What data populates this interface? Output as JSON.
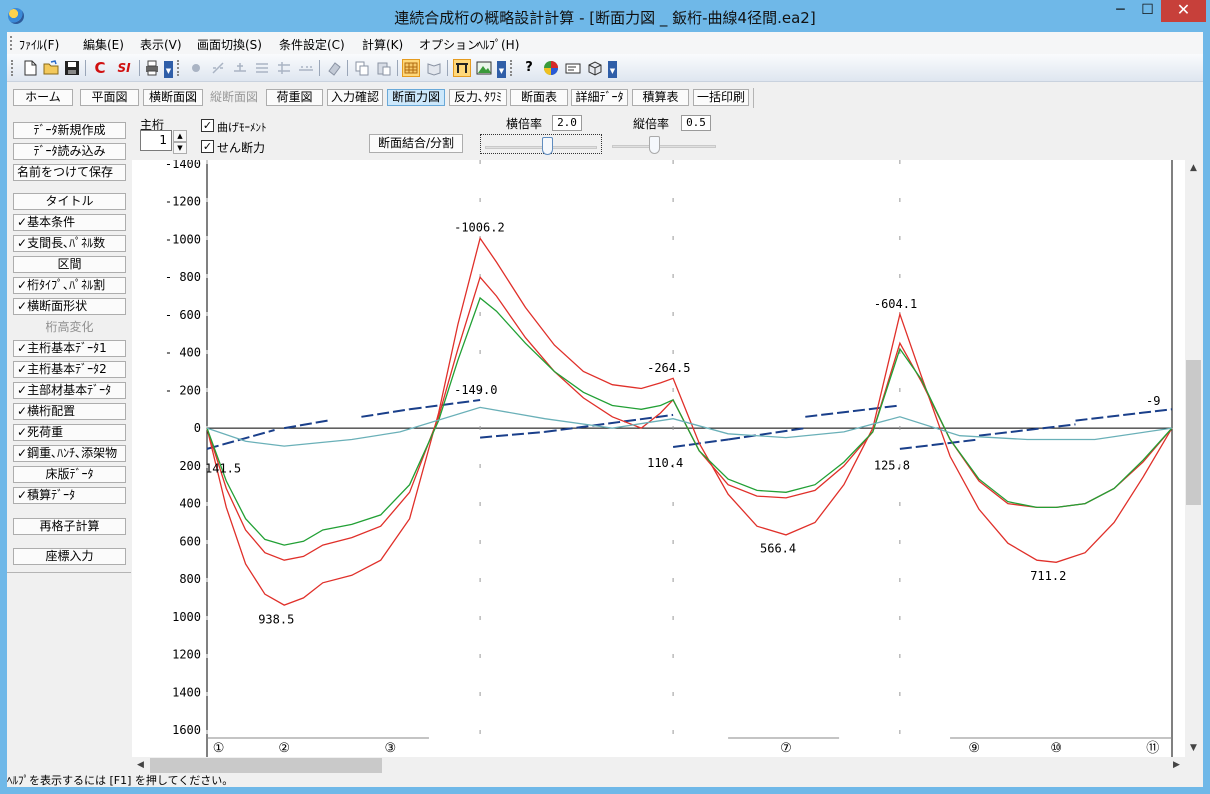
{
  "window": {
    "title": "連続合成桁の概略設計計算 - [断面力図 _ 鈑桁-曲線4径間.ea2]",
    "minimize": "─",
    "maximize": "☐",
    "close": "✕"
  },
  "menu": [
    "ﾌｧｲﾙ(F)",
    "編集(E)",
    "表示(V)",
    "画面切換(S)",
    "条件設定(C)",
    "計算(K)",
    "オプション",
    "ﾍﾙﾌﾟ(H)"
  ],
  "toolbar": {
    "icons": [
      "new-file-icon",
      "open-folder-icon",
      "save-icon",
      "c-icon",
      "si-icon",
      "print-icon",
      "tool-1-icon",
      "tool-2-icon",
      "tool-3-icon",
      "tool-4-icon",
      "tool-5-icon",
      "tool-6-icon",
      "eraser-icon",
      "copy-icon",
      "paste-icon",
      "grid-view-icon",
      "book-icon",
      "frame-icon",
      "mountain-icon",
      "help-icon",
      "color-wheel-icon",
      "card-icon",
      "box-icon"
    ],
    "glyphs": {
      "c": "C",
      "si": "SI",
      "help": "?"
    }
  },
  "nav_tabs": [
    {
      "label": "ホーム",
      "state": "normal"
    },
    {
      "label": "平面図",
      "state": "normal"
    },
    {
      "label": "横断面図",
      "state": "normal"
    },
    {
      "label": "縦断面図",
      "state": "disabled"
    },
    {
      "label": "荷重図",
      "state": "normal"
    },
    {
      "label": "入力確認",
      "state": "normal"
    },
    {
      "label": "断面力図",
      "state": "active"
    },
    {
      "label": "反力､ﾀﾜﾐ",
      "state": "normal"
    },
    {
      "label": "断面表",
      "state": "normal"
    },
    {
      "label": "詳細ﾃﾞｰﾀ",
      "state": "normal"
    },
    {
      "label": "積算表",
      "state": "normal"
    },
    {
      "label": "一括印刷",
      "state": "normal"
    }
  ],
  "sidebar": [
    {
      "label": "ﾃﾞｰﾀ新規作成",
      "state": "normal",
      "check": false
    },
    {
      "label": "ﾃﾞｰﾀ読み込み",
      "state": "normal",
      "check": false
    },
    {
      "label": "名前をつけて保存",
      "state": "normal",
      "check": false
    },
    {
      "label": "タイトル",
      "state": "normal",
      "check": false
    },
    {
      "label": "基本条件",
      "state": "normal",
      "check": true
    },
    {
      "label": "支間長､ﾊﾟﾈﾙ数",
      "state": "normal",
      "check": true
    },
    {
      "label": "区間",
      "state": "normal",
      "check": false
    },
    {
      "label": "桁ﾀｲﾌﾟ､ﾊﾟﾈﾙ割",
      "state": "normal",
      "check": true
    },
    {
      "label": "横断面形状",
      "state": "normal",
      "check": true
    },
    {
      "label": "桁高変化",
      "state": "disabled",
      "check": false
    },
    {
      "label": "主桁基本ﾃﾞｰﾀ1",
      "state": "normal",
      "check": true
    },
    {
      "label": "主桁基本ﾃﾞｰﾀ2",
      "state": "normal",
      "check": true
    },
    {
      "label": "主部材基本ﾃﾞｰﾀ",
      "state": "normal",
      "check": true
    },
    {
      "label": "横桁配置",
      "state": "normal",
      "check": true
    },
    {
      "label": "死荷重",
      "state": "normal",
      "check": true
    },
    {
      "label": "鋼重､ﾊﾝﾁ､添架物",
      "state": "normal",
      "check": true
    },
    {
      "label": "床版ﾃﾞｰﾀ",
      "state": "normal",
      "check": false
    },
    {
      "label": "積算ﾃﾞｰﾀ",
      "state": "normal",
      "check": true
    },
    {
      "label": "再格子計算",
      "state": "normal",
      "check": false
    },
    {
      "label": "座標入力",
      "state": "normal",
      "check": false
    }
  ],
  "check_glyph": "✓",
  "controls": {
    "girder_label": "主桁",
    "girder_value": "1",
    "bending_label": "曲げﾓｰﾒﾝﾄ",
    "bending_checked": true,
    "shear_label": "せん断力",
    "shear_checked": true,
    "combine_button": "断面結合/分割",
    "h_scale_label": "横倍率",
    "h_scale_value": "2.0",
    "h_scale_level": 0.55,
    "v_scale_label": "縦倍率",
    "v_scale_value": "0.5",
    "v_scale_level": 0.4
  },
  "chart_data": {
    "type": "line",
    "y_reversed": true,
    "ylim": [
      -1400,
      1600
    ],
    "y_ticks": [
      "-1400",
      "-1200",
      "-1000",
      "- 800",
      "- 600",
      "- 400",
      "- 200",
      "0",
      "200",
      "400",
      "600",
      "800",
      "1000",
      "1200",
      "1400",
      "1600"
    ],
    "x_supports": [
      0,
      283,
      483,
      718,
      1000
    ],
    "node_labels": [
      {
        "label": "①",
        "x": 12
      },
      {
        "label": "②",
        "x": 80
      },
      {
        "label": "③",
        "x": 190
      },
      {
        "label": "⑦",
        "x": 600
      },
      {
        "label": "⑨",
        "x": 795
      },
      {
        "label": "⑩",
        "x": 880
      },
      {
        "label": "⑪",
        "x": 980
      }
    ],
    "annotations": [
      {
        "text": "-1006.2",
        "x": 283,
        "y": -1010
      },
      {
        "text": "-264.5",
        "x": 483,
        "y": -265
      },
      {
        "text": "-604.1",
        "x": 718,
        "y": -605
      },
      {
        "text": "-149.0",
        "x": 283,
        "y": -150
      },
      {
        "text": "141.5",
        "x": 0,
        "y": 140
      },
      {
        "text": "938.5",
        "x": 80,
        "y": 940
      },
      {
        "text": "110.4",
        "x": 483,
        "y": 110
      },
      {
        "text": "566.4",
        "x": 600,
        "y": 565
      },
      {
        "text": "125.8",
        "x": 718,
        "y": 125
      },
      {
        "text": "711.2",
        "x": 880,
        "y": 710
      },
      {
        "text": "-9",
        "x": 1000,
        "y": -90
      }
    ],
    "series": [
      {
        "color": "#e0302a",
        "x": [
          0,
          20,
          40,
          60,
          80,
          100,
          120,
          150,
          180,
          210,
          240,
          260,
          283,
          300,
          330,
          360,
          390,
          420,
          450,
          470,
          483,
          510,
          540,
          570,
          600,
          630,
          660,
          690,
          718,
          740,
          770,
          800,
          830,
          860,
          880,
          910,
          940,
          970,
          1000
        ],
        "y": [
          0,
          420,
          720,
          880,
          938,
          900,
          820,
          780,
          700,
          480,
          -80,
          -550,
          -1006,
          -880,
          -640,
          -440,
          -300,
          -230,
          -210,
          -240,
          -264,
          80,
          350,
          520,
          566,
          500,
          300,
          0,
          -604,
          -280,
          150,
          430,
          610,
          700,
          711,
          660,
          500,
          260,
          0
        ]
      },
      {
        "color": "#e0302a",
        "x": [
          0,
          20,
          40,
          60,
          80,
          100,
          120,
          150,
          180,
          210,
          240,
          260,
          283,
          300,
          330,
          360,
          390,
          420,
          450,
          470,
          483,
          510,
          540,
          570,
          600,
          630,
          660,
          690,
          718,
          740,
          770,
          800,
          830,
          860,
          880,
          910,
          940,
          970,
          1000
        ],
        "y": [
          0,
          320,
          540,
          660,
          700,
          680,
          620,
          580,
          520,
          340,
          -60,
          -420,
          -800,
          -700,
          -480,
          -300,
          -160,
          -60,
          0,
          -80,
          -150,
          120,
          300,
          360,
          370,
          330,
          200,
          20,
          -450,
          -250,
          60,
          280,
          400,
          420,
          420,
          400,
          320,
          180,
          0
        ]
      },
      {
        "color": "#22a035",
        "x": [
          0,
          20,
          40,
          60,
          80,
          100,
          120,
          150,
          180,
          210,
          240,
          260,
          283,
          300,
          330,
          360,
          390,
          420,
          450,
          470,
          483,
          510,
          540,
          570,
          600,
          630,
          660,
          690,
          718,
          740,
          770,
          800,
          830,
          860,
          880,
          910,
          940,
          970,
          1000
        ],
        "y": [
          0,
          280,
          480,
          590,
          620,
          600,
          540,
          510,
          460,
          300,
          -40,
          -360,
          -690,
          -620,
          -450,
          -300,
          -190,
          -120,
          -100,
          -120,
          -150,
          120,
          270,
          330,
          340,
          300,
          180,
          20,
          -420,
          -260,
          60,
          270,
          390,
          420,
          420,
          400,
          320,
          170,
          0
        ]
      },
      {
        "color": "#6ab0b8",
        "x": [
          0,
          40,
          80,
          150,
          200,
          283,
          350,
          420,
          483,
          540,
          600,
          660,
          718,
          780,
          850,
          920,
          1000
        ],
        "y": [
          0,
          70,
          95,
          60,
          20,
          -110,
          -50,
          0,
          -50,
          30,
          50,
          20,
          -60,
          40,
          60,
          60,
          0
        ]
      }
    ],
    "shear_segments": [
      {
        "x1": 0,
        "x2": 70,
        "y1": 110,
        "y2": 10
      },
      {
        "x1": 80,
        "x2": 125,
        "y1": 0,
        "y2": -40
      },
      {
        "x1": 160,
        "x2": 210,
        "y1": -60,
        "y2": -100
      },
      {
        "x1": 210,
        "x2": 283,
        "y1": -100,
        "y2": -149
      },
      {
        "x1": 283,
        "x2": 350,
        "y1": 50,
        "y2": 20
      },
      {
        "x1": 350,
        "x2": 483,
        "y1": 20,
        "y2": -70
      },
      {
        "x1": 483,
        "x2": 540,
        "y1": 100,
        "y2": 60
      },
      {
        "x1": 540,
        "x2": 620,
        "y1": 60,
        "y2": 0
      },
      {
        "x1": 620,
        "x2": 718,
        "y1": -60,
        "y2": -120
      },
      {
        "x1": 718,
        "x2": 800,
        "y1": 110,
        "y2": 60
      },
      {
        "x1": 800,
        "x2": 900,
        "y1": 40,
        "y2": -20
      },
      {
        "x1": 900,
        "x2": 1000,
        "y1": -40,
        "y2": -100
      }
    ]
  },
  "status": "ﾍﾙﾌﾟを表示するには [F1] を押してください。"
}
